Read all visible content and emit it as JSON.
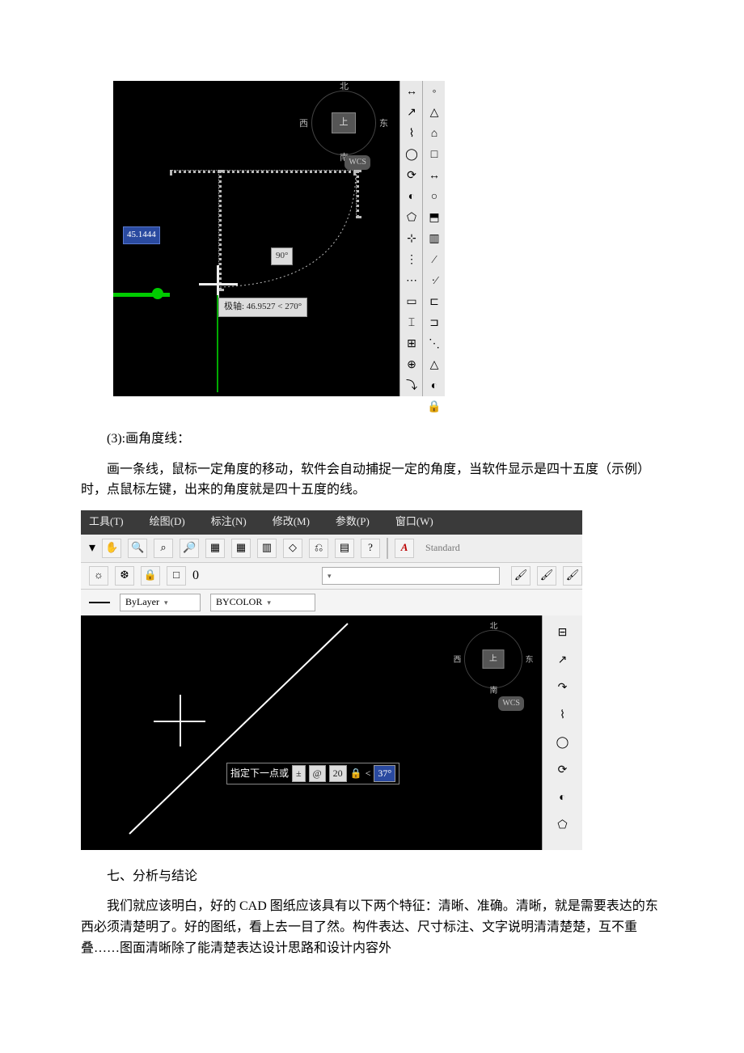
{
  "fig1": {
    "compass": {
      "n": "北",
      "s": "南",
      "e": "东",
      "w": "西",
      "center": "上"
    },
    "wcs": "WCS",
    "dim_value": "45.1444",
    "angle_tag": "90°",
    "polar": "极轴: 46.9527 < 270°",
    "tool_icons_left": [
      "↔",
      "↗",
      "⌇",
      "◯",
      "⟳",
      "◐",
      "⬠",
      "⊹",
      "⋮",
      "⋯",
      "▭",
      "⌶",
      "⊞",
      "⊕",
      "⤵"
    ],
    "tool_icons_right": [
      "◦",
      "△",
      "⌂",
      "□",
      "↔",
      "○",
      "⬒",
      "▥",
      "⁄",
      "·⁄",
      "⊏",
      "⊐",
      "⋱",
      "△",
      "◐",
      "🔒"
    ]
  },
  "text": {
    "step3": "(3):画角度线：",
    "para1": "画一条线，鼠标一定角度的移动，软件会自动捕捉一定的角度，当软件显示是四十五度（示例）时，点鼠标左键，出来的角度就是四十五度的线。",
    "heading7": "七、分析与结论",
    "para2": "我们就应该明白，好的 CAD 图纸应该具有以下两个特征：清晰、准确。清晰，就是需要表达的东西必须清楚明了。好的图纸，看上去一目了然。构件表达、尺寸标注、文字说明清清楚楚，互不重叠……图面清晰除了能清楚表达设计思路和设计内容外"
  },
  "fig2": {
    "menus": [
      "工具(T)",
      "绘图(D)",
      "标注(N)",
      "修改(M)",
      "参数(P)",
      "窗口(W)"
    ],
    "standard": "Standard",
    "layer_field": "0",
    "bylayer": "ByLayer",
    "bycolor": "BYCOLOR",
    "compass": {
      "n": "北",
      "s": "南",
      "e": "东",
      "w": "西",
      "center": "上"
    },
    "wcs": "WCS",
    "prompt": "指定下一点或",
    "val_len": "20",
    "val_ang": "37°",
    "icons_row": [
      "✋",
      "🔍",
      "⌕",
      "🔎",
      "▦",
      "▦",
      "▥",
      "◇",
      "⎌",
      "▤",
      "?",
      "A"
    ],
    "layer_icons": [
      "☼",
      "❆",
      "🔒",
      "□"
    ],
    "brush_icons": [
      "🖌",
      "🖌",
      "🖌"
    ],
    "right_icons": [
      "⊟",
      "↗",
      "↷",
      "⌇",
      "◯",
      "⟳",
      "◐",
      "⬠"
    ]
  }
}
